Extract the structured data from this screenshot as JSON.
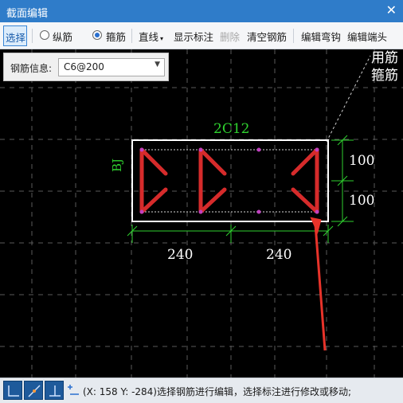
{
  "window": {
    "title": "截面编辑",
    "close_glyph": "✕"
  },
  "toolbar": {
    "select": "选择",
    "longitudinal": "纵筋",
    "stirrup": "箍筋",
    "line": "直线",
    "show_annotation": "显示标注",
    "delete": "删除",
    "clear_rebar": "清空钢筋",
    "edit_hook": "编辑弯钩",
    "edit_end": "编辑端头",
    "selected_mode": "stirrup"
  },
  "info_panel": {
    "label": "钢筋信息:",
    "value": "C6@200"
  },
  "drawing": {
    "top_rebar": "2C12",
    "side_label": "BJ",
    "dim_bottom_left": "240",
    "dim_bottom_right": "240",
    "dim_right_top": "100",
    "dim_right_bottom": "100",
    "note_line1": "用筋",
    "note_line2": "箍筋"
  },
  "statusbar": {
    "text": "(X: 158 Y: -284)选择钢筋进行编辑，选择标注进行修改或移动;"
  },
  "colors": {
    "title_bar": "#2f7cc9",
    "canvas_bg": "#000000",
    "section_outline": "#ffffff",
    "stirrup": "#d62b2b",
    "dimension": "#2fd12f",
    "grid": "#5a5a5a",
    "arrow": "#e8332a",
    "rebar_point": "#c040c0"
  }
}
